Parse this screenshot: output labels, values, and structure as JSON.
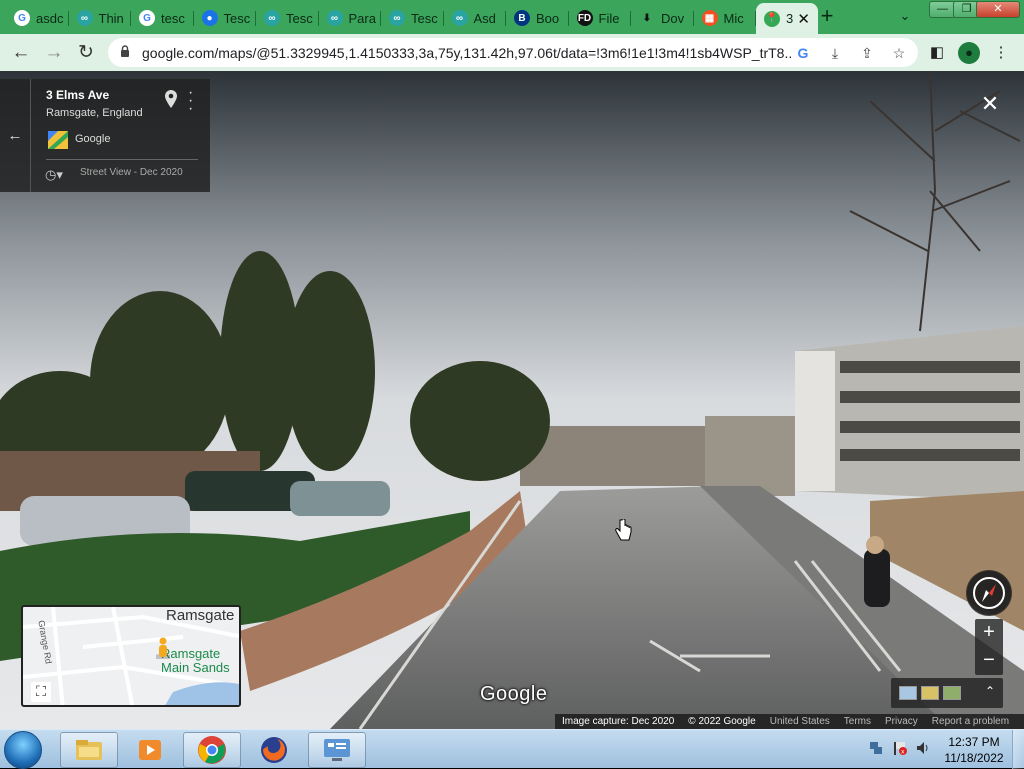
{
  "browser": {
    "tabs": [
      {
        "label": "asdc",
        "icon": "google-icon"
      },
      {
        "label": "Thin",
        "icon": "tesco-icon"
      },
      {
        "label": "tesc",
        "icon": "google-icon"
      },
      {
        "label": "Tesc",
        "icon": "chrome-page-icon"
      },
      {
        "label": "Tesc",
        "icon": "tesco-icon"
      },
      {
        "label": "Para",
        "icon": "tesco-icon"
      },
      {
        "label": "Tesc",
        "icon": "tesco-icon"
      },
      {
        "label": "Asd",
        "icon": "tesco-icon"
      },
      {
        "label": "Boo",
        "icon": "booking-icon"
      },
      {
        "label": "File",
        "icon": "fd-icon"
      },
      {
        "label": "Dov",
        "icon": "download-icon"
      },
      {
        "label": "Mic",
        "icon": "microsoft-icon"
      },
      {
        "label": "3",
        "icon": "google-maps-icon",
        "active": true
      }
    ],
    "new_tab": "+",
    "window_controls": {
      "minimize": "—",
      "maximize": "❐",
      "close": "✕"
    }
  },
  "toolbar": {
    "url": "google.com/maps/@51.3329945,1.4150333,3a,75y,131.42h,97.06t/data=!3m6!1e1!3m4!1sb4WSP_trT8..."
  },
  "streetview": {
    "place_title": "3 Elms Ave",
    "place_subtitle": "Ramsgate, England",
    "provider": "Google",
    "date_label": "Street View - Dec 2020",
    "watermark": "Google",
    "close": "✕",
    "minimap": {
      "town": "Ramsgate",
      "poi": "Ramsgate\nMain Sands",
      "road": "Grange Rd"
    },
    "zoom_in": "+",
    "zoom_out": "−",
    "footer": {
      "capture": "Image capture: Dec 2020",
      "copyright": "© 2022 Google",
      "region": "United States",
      "terms": "Terms",
      "privacy": "Privacy",
      "report": "Report a problem"
    }
  },
  "taskbar": {
    "apps": [
      "explorer",
      "media-player",
      "chrome",
      "firefox",
      "control-panel"
    ],
    "time": "12:37 PM",
    "date": "11/18/2022"
  }
}
